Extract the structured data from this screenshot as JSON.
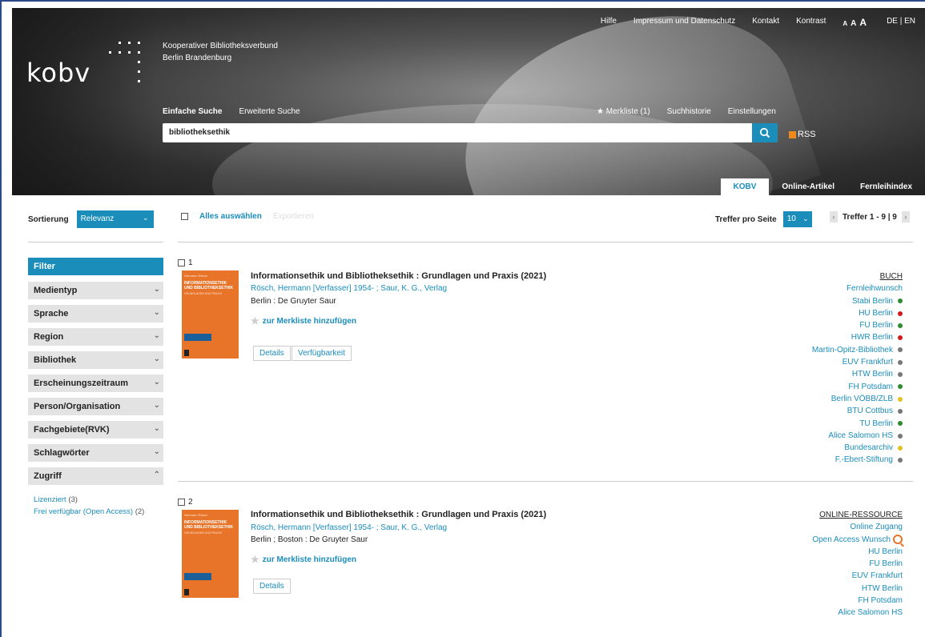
{
  "header": {
    "logo": "kobv",
    "org_line1": "Kooperativer Bibliotheksverbund",
    "org_line2": "Berlin Brandenburg",
    "topnav": [
      "Hilfe",
      "Impressum und Datenschutz",
      "Kontakt",
      "Kontrast"
    ],
    "font_sizes": [
      "A",
      "A",
      "A"
    ],
    "language": "DE | EN",
    "search_tabs": [
      "Einfache Suche",
      "Erweiterte Suche"
    ],
    "merkliste": "Merkliste (1)",
    "suchhistorie": "Suchhistorie",
    "einstellungen": "Einstellungen",
    "search_value": "bibliotheksethik",
    "rss": "RSS",
    "tabs": [
      "KOBV",
      "Online-Artikel",
      "Fernleihindex"
    ]
  },
  "sidebar": {
    "sort_label": "Sortierung",
    "sort_value": "Relevanz",
    "filter_label": "Filter",
    "facets": [
      "Medientyp",
      "Sprache",
      "Region",
      "Bibliothek",
      "Erscheinungszeitraum",
      "Person/Organisation",
      "Fachgebiete(RVK)",
      "Schlagwörter",
      "Zugriff"
    ],
    "access": [
      {
        "label": "Lizenziert",
        "count": "(3)"
      },
      {
        "label": "Frei verfügbar (Open Access)",
        "count": "(2)"
      }
    ]
  },
  "toolbar": {
    "select_all": "Alles auswählen",
    "export": "Exportieren",
    "per_page_label": "Treffer pro Seite",
    "per_page_value": "10",
    "hits": "Treffer 1 - 9 | 9"
  },
  "results": [
    {
      "num": "1",
      "title": "Informationsethik und Bibliotheksethik : Grundlagen und Praxis (2021)",
      "authors": "Rösch, Hermann [Verfasser] 1954- ; Saur, K. G., Verlag",
      "publisher": "Berlin : De Gruyter Saur",
      "merkliste": "zur Merkliste hinzufügen",
      "buttons": [
        "Details",
        "Verfügbarkeit"
      ],
      "type": "BUCH",
      "fernleihe": "Fernleihwunsch",
      "libraries": [
        {
          "name": "Stabi Berlin",
          "status": "#2e8b2e"
        },
        {
          "name": "HU Berlin",
          "status": "#d11a1a"
        },
        {
          "name": "FU Berlin",
          "status": "#2e8b2e"
        },
        {
          "name": "HWR Berlin",
          "status": "#d11a1a"
        },
        {
          "name": "Martin-Opitz-Bibliothek",
          "status": "#777777"
        },
        {
          "name": "EUV Frankfurt",
          "status": "#777777"
        },
        {
          "name": "HTW Berlin",
          "status": "#777777"
        },
        {
          "name": "FH Potsdam",
          "status": "#2e8b2e"
        },
        {
          "name": "Berlin VÖBB/ZLB",
          "status": "#e2c21d"
        },
        {
          "name": "BTU Cottbus",
          "status": "#777777"
        },
        {
          "name": "TU Berlin",
          "status": "#2e8b2e"
        },
        {
          "name": "Alice Salomon HS",
          "status": "#777777"
        },
        {
          "name": "Bundesarchiv",
          "status": "#e2c21d"
        },
        {
          "name": "F.-Ebert-Stiftung",
          "status": "#777777"
        }
      ]
    },
    {
      "num": "2",
      "title": "Informationsethik und Bibliotheksethik : Grundlagen und Praxis (2021)",
      "authors": "Rösch, Hermann [Verfasser] 1954- ; Saur, K. G., Verlag",
      "publisher": "Berlin ; Boston : De Gruyter Saur",
      "merkliste": "zur Merkliste hinzufügen",
      "buttons": [
        "Details"
      ],
      "type": "ONLINE-RESSOURCE",
      "online_access": "Online Zugang",
      "open_access_wish": "Open Access Wunsch",
      "libraries": [
        "HU Berlin",
        "FU Berlin",
        "EUV Frankfurt",
        "HTW Berlin",
        "FH Potsdam",
        "Alice Salomon HS"
      ]
    }
  ],
  "cover": {
    "author": "Hermann Rösch",
    "title": "INFORMATIONSETHIK UND BIBLIOTHEKSETHIK",
    "subtitle": "GRUNDLAGEN UND PRAXIS"
  }
}
